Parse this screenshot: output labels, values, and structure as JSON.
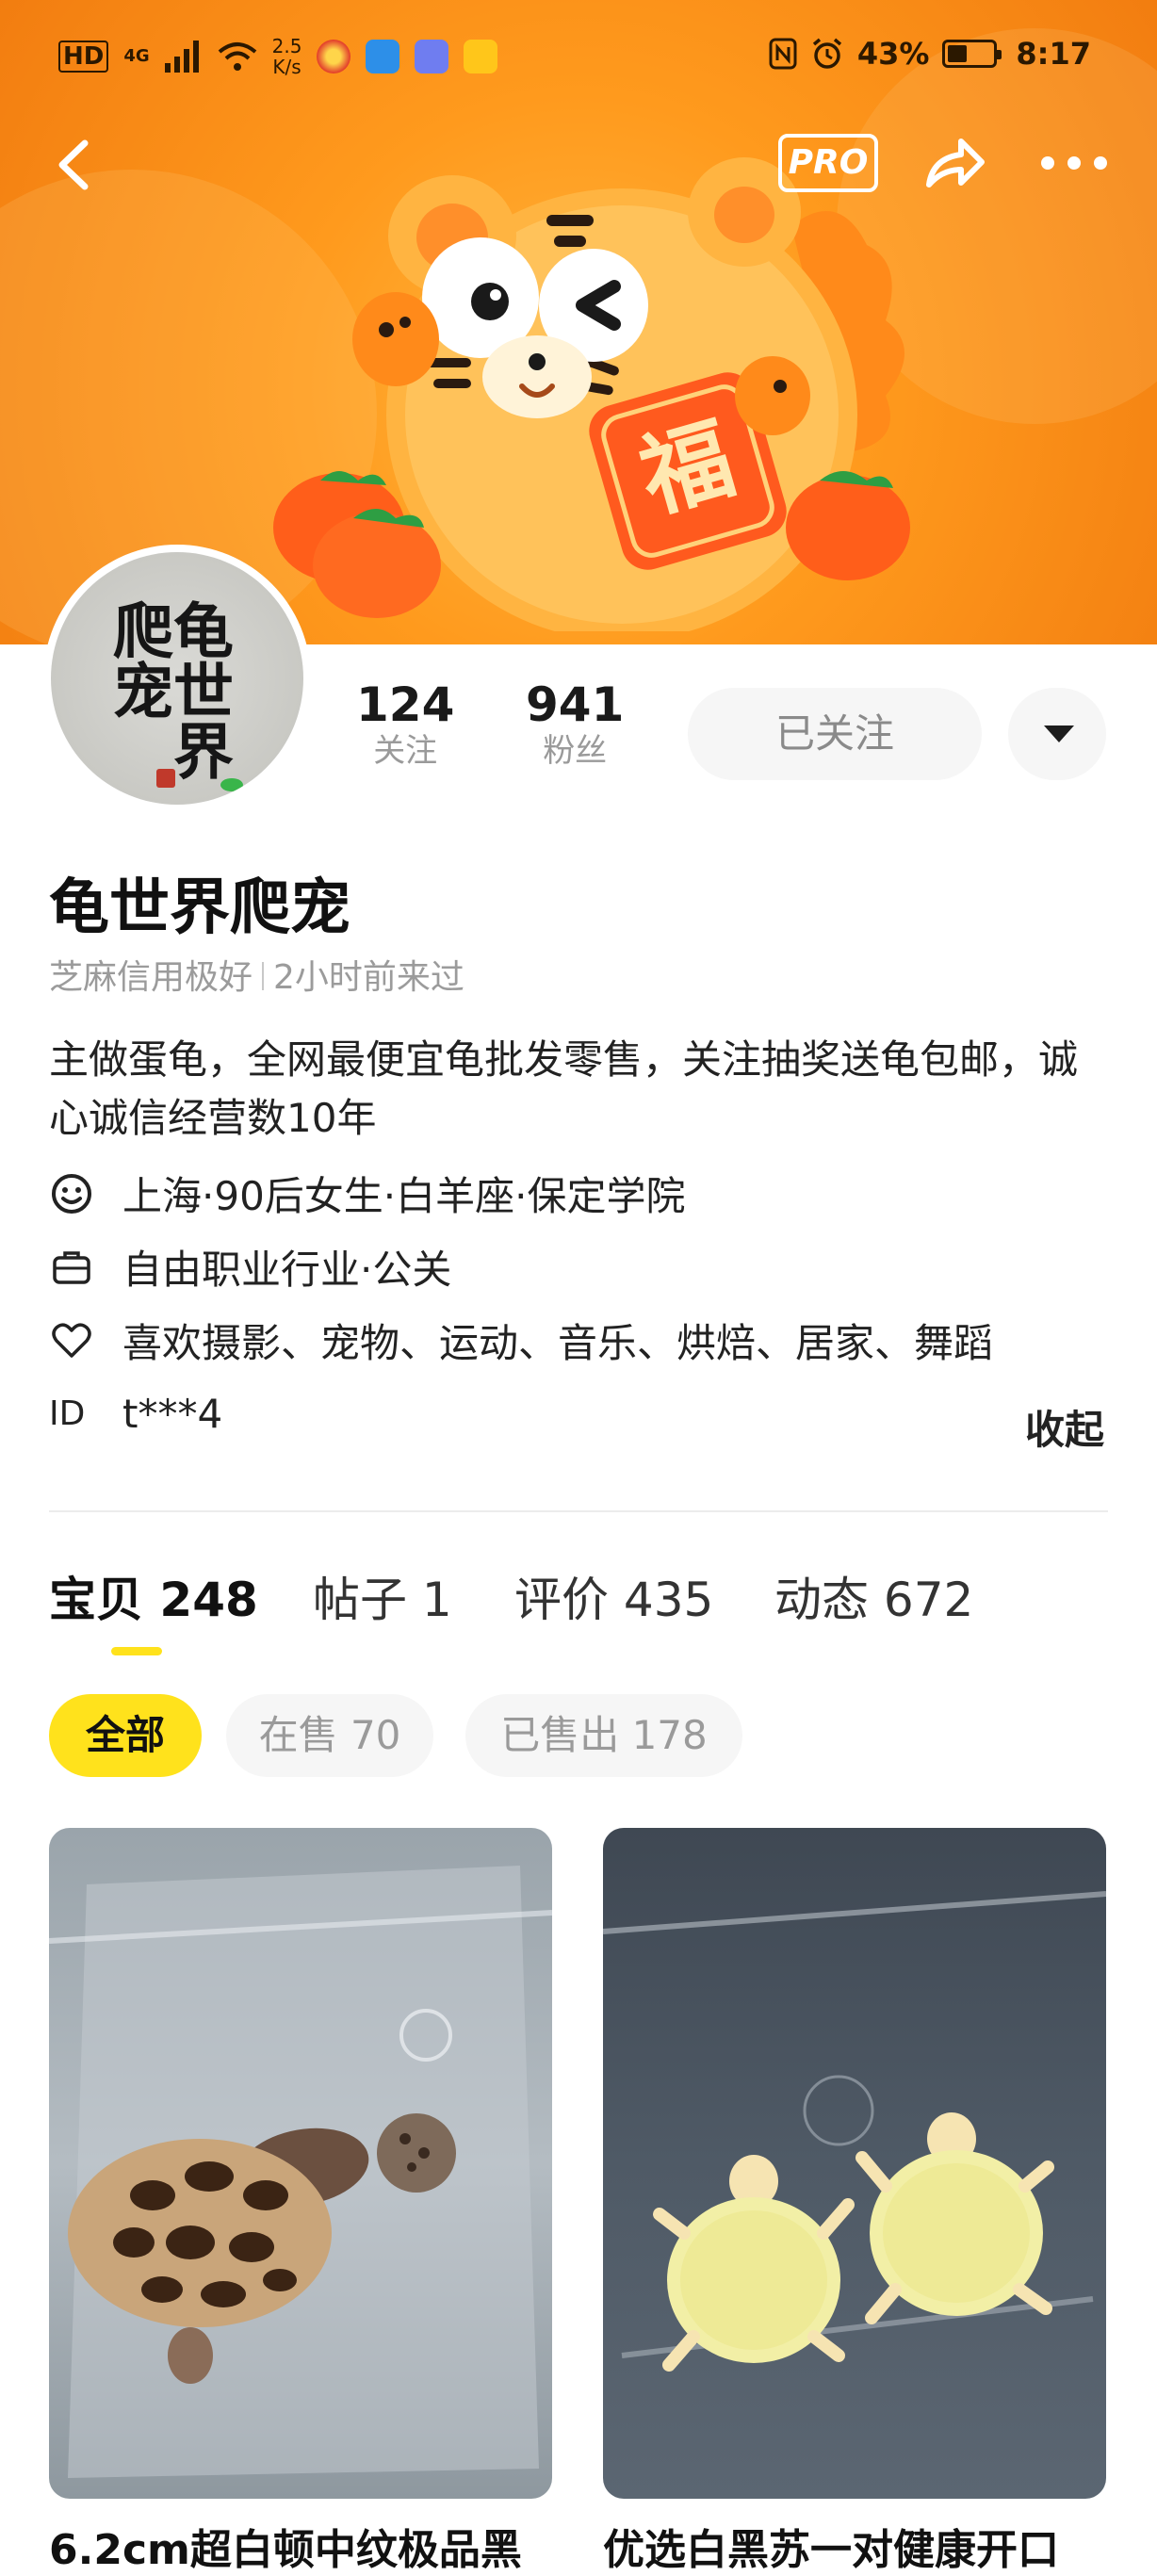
{
  "status_bar": {
    "signal_label": "HD",
    "network_label": "4G",
    "net_speed_value": "2.5",
    "net_speed_unit": "K/s",
    "battery_percent": "43%",
    "battery_level": 0.43,
    "time": "8:17"
  },
  "header": {
    "pro_badge": "PRO",
    "icons": [
      "back-arrow-icon",
      "share-icon",
      "more-icon"
    ]
  },
  "profile": {
    "avatar_text": "龟世界爬宠",
    "following_count": "124",
    "following_label": "关注",
    "followers_count": "941",
    "followers_label": "粉丝",
    "follow_state_label": "已关注",
    "name": "龟世界爬宠",
    "credit": "芝麻信用极好",
    "last_seen": "2小时前来过",
    "bio": "主做蛋龟，全网最便宜龟批发零售，关注抽奖送龟包邮，诚心诚信经营数10年",
    "details": {
      "basic": "上海·90后女生·白羊座·保定学院",
      "job": "自由职业行业·公关",
      "hobbies": "喜欢摄影、宠物、运动、音乐、烘焙、居家、舞蹈",
      "id_label": "ID",
      "id_value": "t***4"
    },
    "collapse_label": "收起"
  },
  "tabs": [
    {
      "label": "宝贝",
      "count": "248"
    },
    {
      "label": "帖子",
      "count": "1"
    },
    {
      "label": "评价",
      "count": "435"
    },
    {
      "label": "动态",
      "count": "672"
    }
  ],
  "filters": [
    {
      "label": "全部"
    },
    {
      "label": "在售 70"
    },
    {
      "label": "已售出 178"
    }
  ],
  "products": [
    {
      "title": "6.2cm超白顿中纹极品黑"
    },
    {
      "title": "优选白黑苏一对健康开口"
    }
  ],
  "colors": {
    "accent_yellow": "#ffe21c",
    "banner_orange": "#ff9a1d"
  }
}
